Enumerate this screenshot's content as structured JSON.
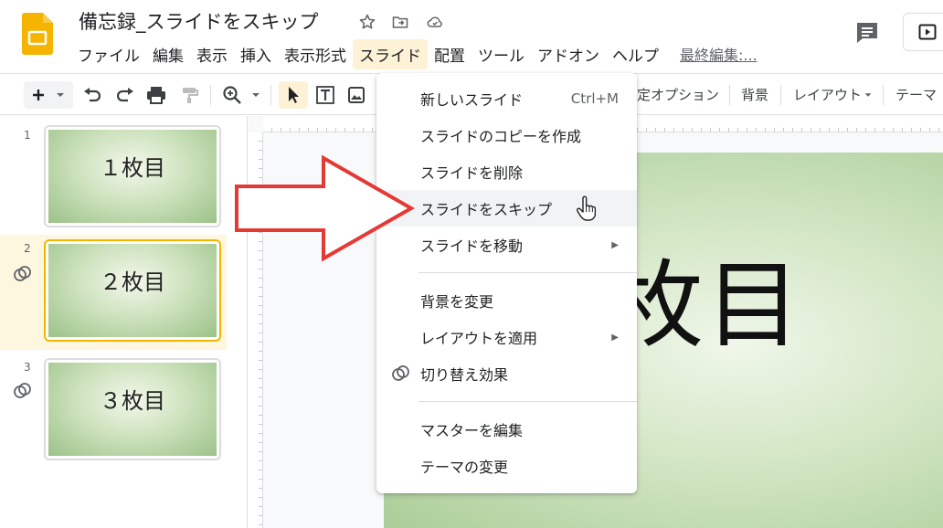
{
  "header": {
    "title": "備忘録_スライドをスキップ",
    "last_edit": "最終編集:..."
  },
  "menubar": [
    {
      "label": "ファイル"
    },
    {
      "label": "編集"
    },
    {
      "label": "表示"
    },
    {
      "label": "挿入"
    },
    {
      "label": "表示形式"
    },
    {
      "label": "スライド",
      "active": true
    },
    {
      "label": "配置"
    },
    {
      "label": "ツール"
    },
    {
      "label": "アドオン"
    },
    {
      "label": "ヘルプ"
    }
  ],
  "toolbar": {
    "partial_transition_options": "定オプション",
    "background": "背景",
    "layout": "レイアウト",
    "theme": "テーマ"
  },
  "filmstrip": [
    {
      "number": "1",
      "label": "１枚目",
      "selected": false,
      "has_transition": false
    },
    {
      "number": "2",
      "label": "２枚目",
      "selected": true,
      "has_transition": true
    },
    {
      "number": "3",
      "label": "３枚目",
      "selected": false,
      "has_transition": true
    }
  ],
  "main_slide": {
    "title": "２枚目"
  },
  "slide_menu": {
    "new_slide": "新しいスライド",
    "new_slide_shortcut": "Ctrl+M",
    "duplicate": "スライドのコピーを作成",
    "delete": "スライドを削除",
    "skip": "スライドをスキップ",
    "move": "スライドを移動",
    "change_background": "背景を変更",
    "apply_layout": "レイアウトを適用",
    "transition": "切り替え効果",
    "edit_master": "マスターを編集",
    "change_theme": "テーマの変更"
  },
  "colors": {
    "accent_yellow": "#f4b400",
    "menu_active_bg": "#fdf1d6",
    "arrow_red": "#e53935",
    "slide_green": "#a9cc96"
  }
}
